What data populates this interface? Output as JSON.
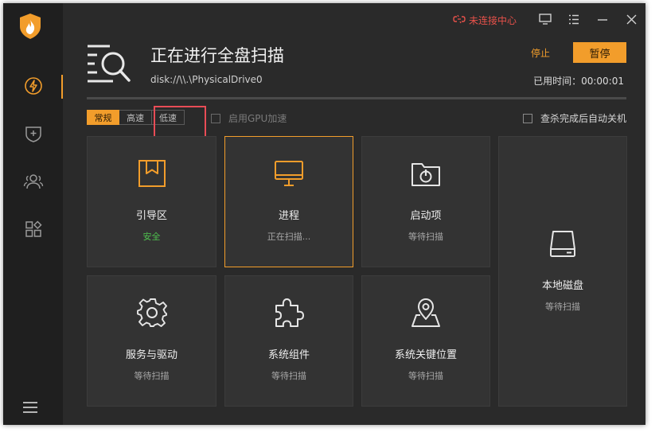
{
  "window": {
    "connection_label": "未连接中心",
    "colors": {
      "accent": "#f29d2b",
      "danger": "#e8514a",
      "safe": "#4fc24f"
    }
  },
  "sidebar": {
    "items": [
      {
        "icon": "lightning-icon",
        "active": true
      },
      {
        "icon": "shield-plus-icon",
        "active": false
      },
      {
        "icon": "users-icon",
        "active": false
      },
      {
        "icon": "apps-icon",
        "active": false
      }
    ]
  },
  "scan": {
    "title": "正在进行全盘扫描",
    "path": "disk://\\\\.\\PhysicalDrive0",
    "stop_label": "停止",
    "pause_label": "暂停",
    "elapsed": "已用时间：00:00:01",
    "progress": 0.0
  },
  "speed": {
    "options": [
      "常规",
      "高速",
      "低速"
    ],
    "selected": "常规"
  },
  "options": {
    "gpu_label": "启用GPU加速",
    "shutdown_label": "查杀完成后自动关机"
  },
  "cards": [
    {
      "title": "引导区",
      "status": "安全",
      "icon": "bookmark-icon"
    },
    {
      "title": "进程",
      "status": "正在扫描...",
      "icon": "monitor-icon"
    },
    {
      "title": "启动项",
      "status": "等待扫描",
      "icon": "power-folder-icon"
    },
    {
      "title": "本地磁盘",
      "status": "等待扫描",
      "icon": "disk-icon"
    },
    {
      "title": "服务与驱动",
      "status": "等待扫描",
      "icon": "gear-icon"
    },
    {
      "title": "系统组件",
      "status": "等待扫描",
      "icon": "puzzle-icon"
    },
    {
      "title": "系统关键位置",
      "status": "等待扫描",
      "icon": "map-pin-icon"
    }
  ]
}
